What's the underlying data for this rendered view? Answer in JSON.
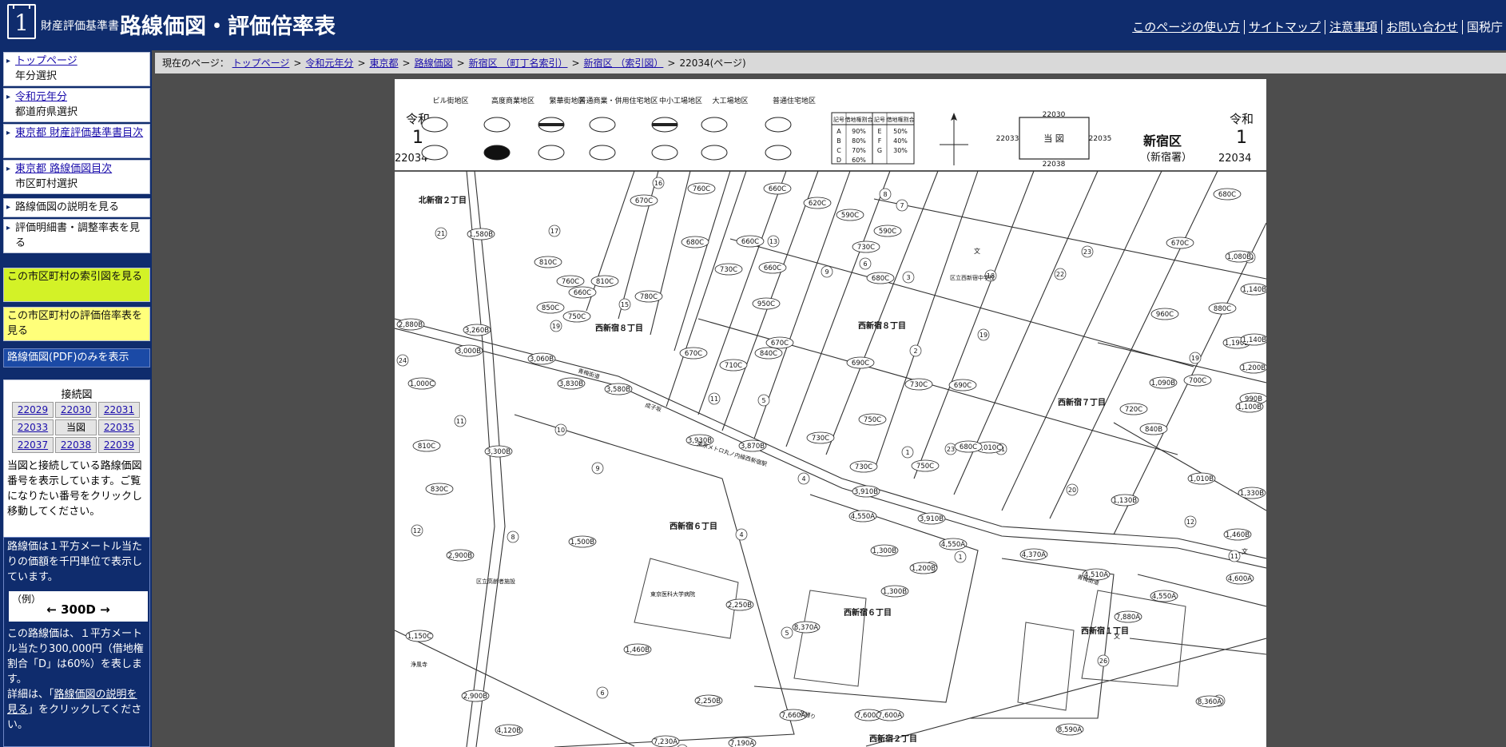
{
  "header": {
    "logo_number": "1",
    "site_sub": "財産評価基準書",
    "site_main": "路線価図・評価倍率表",
    "links": [
      "このページの使い方",
      "サイトマップ",
      "注意事項",
      "お問い合わせ"
    ],
    "agency": "国税庁"
  },
  "sidebar": {
    "nav": [
      {
        "link": "トップページ",
        "text": "年分選択"
      },
      {
        "link": "令和元年分",
        "text": "都道府県選択"
      },
      {
        "link": "東京都 財産評価基準書目次",
        "text": ""
      },
      {
        "link": "東京都 路線価図目次",
        "text": "市区町村選択"
      },
      {
        "link": "",
        "text": "路線価図の説明を見る"
      },
      {
        "link": "",
        "text": "評価明細書・調整率表を見る"
      }
    ],
    "index_map": "この市区町村の索引図を見る",
    "multiplier_table": "この市区町村の評価倍率表を見る",
    "pdf_only": "路線価図(PDF)のみを表示",
    "connect": {
      "title": "接続図",
      "cells": [
        "22029",
        "22030",
        "22031",
        "22033",
        "当図",
        "22035",
        "22037",
        "22038",
        "22039"
      ],
      "description": "当図と接続している路線価図番号を表示しています。ご覧になりたい番号をクリックし移動してください。"
    },
    "legend": {
      "intro": "路線価は１平方メートル当たりの価額を千円単位で表示しています。",
      "example_label": "（例）",
      "example_value": "← 300D →",
      "explanation": "この路線価は、１平方メートル当たり300,000円（借地権割合「D」は60%）を表します。",
      "detail_prefix": "詳細は、「",
      "detail_link": "路線価図の説明を見る",
      "detail_suffix": "」をクリックしてください。"
    }
  },
  "breadcrumb": {
    "prefix": "現在のページ：",
    "items": [
      "トップページ",
      "令和元年分",
      "東京都",
      "路線価図",
      "新宿区 （町丁名索引）",
      "新宿区 （索引図）"
    ],
    "current": "22034(ページ)"
  },
  "map": {
    "era": "令和",
    "year": "1",
    "page": "22034",
    "ward": "新宿区",
    "office": "（新宿署）",
    "legend_titles": [
      "ビル街地区",
      "高度商業地区",
      "繁華街地区",
      "普通商業・併用住宅地区",
      "中小工場地区",
      "大工場地区",
      "普通住宅地区"
    ],
    "ratio_header": [
      "記号",
      "借地権割合",
      "記号",
      "借地権割合"
    ],
    "ratios": [
      [
        "A",
        "90%",
        "E",
        "50%"
      ],
      [
        "B",
        "80%",
        "F",
        "40%"
      ],
      [
        "C",
        "70%",
        "G",
        "30%"
      ],
      [
        "D",
        "60%",
        "",
        ""
      ]
    ],
    "adjacent": {
      "top": "22030",
      "left": "22033",
      "center": "当 図",
      "right": "22035",
      "bottom": "22038"
    },
    "districts": [
      "北新宿２丁目",
      "西新宿８丁目",
      "西新宿８丁目",
      "西新宿７丁目",
      "西新宿６丁目",
      "西新宿６丁目",
      "西新宿１丁目",
      "西新宿２丁目"
    ],
    "street_names": [
      "青梅街道",
      "成子坂",
      "東京メトロ丸ノ内線西新宿駅",
      "北通り",
      "青梅街道"
    ],
    "facilities": [
      "区立西新宿中学校",
      "東京医科大学病院",
      "区立高齢者施設",
      "浄風寺"
    ],
    "route_values": [
      "1,580B",
      "760C",
      "660C",
      "620C",
      "590C",
      "590C",
      "670C",
      "680C",
      "730C",
      "950C",
      "810C",
      "760C",
      "810C",
      "660C",
      "850C",
      "750C",
      "780C",
      "660C",
      "660C",
      "670C",
      "730C",
      "680C",
      "2,880B",
      "3,260B",
      "3,000B",
      "3,060B",
      "3,830B",
      "3,580B",
      "670C",
      "710C",
      "840C",
      "690C",
      "730C",
      "690C",
      "1,000C",
      "3,930B",
      "3,870B",
      "730C",
      "750C",
      "730C",
      "1,010C",
      "680C",
      "810C",
      "3,300B",
      "830C",
      "750C",
      "3,910B",
      "3,910B",
      "4,550A",
      "1,500B",
      "1,300B",
      "1,200B",
      "4,550A",
      "4,370A",
      "4,510A",
      "4,550A",
      "2,900B",
      "2,250B",
      "1,300B",
      "7,660A",
      "8,370A",
      "7,880A",
      "1,150C",
      "1,460B",
      "2,900B",
      "2,250B",
      "7,600A",
      "7,600A",
      "4,120B",
      "7,230A",
      "7,190A",
      "8,590A",
      "8,360A",
      "680C",
      "670C",
      "1,080B",
      "1,140B",
      "880C",
      "960C",
      "1,190B",
      "1,140B",
      "1,090B",
      "700C",
      "1,200B",
      "990B",
      "720C",
      "840B",
      "1,100B",
      "1,010B",
      "1,130B",
      "1,330B",
      "1,460B",
      "4,600A"
    ],
    "labels": [
      "文",
      "文",
      "文"
    ]
  }
}
